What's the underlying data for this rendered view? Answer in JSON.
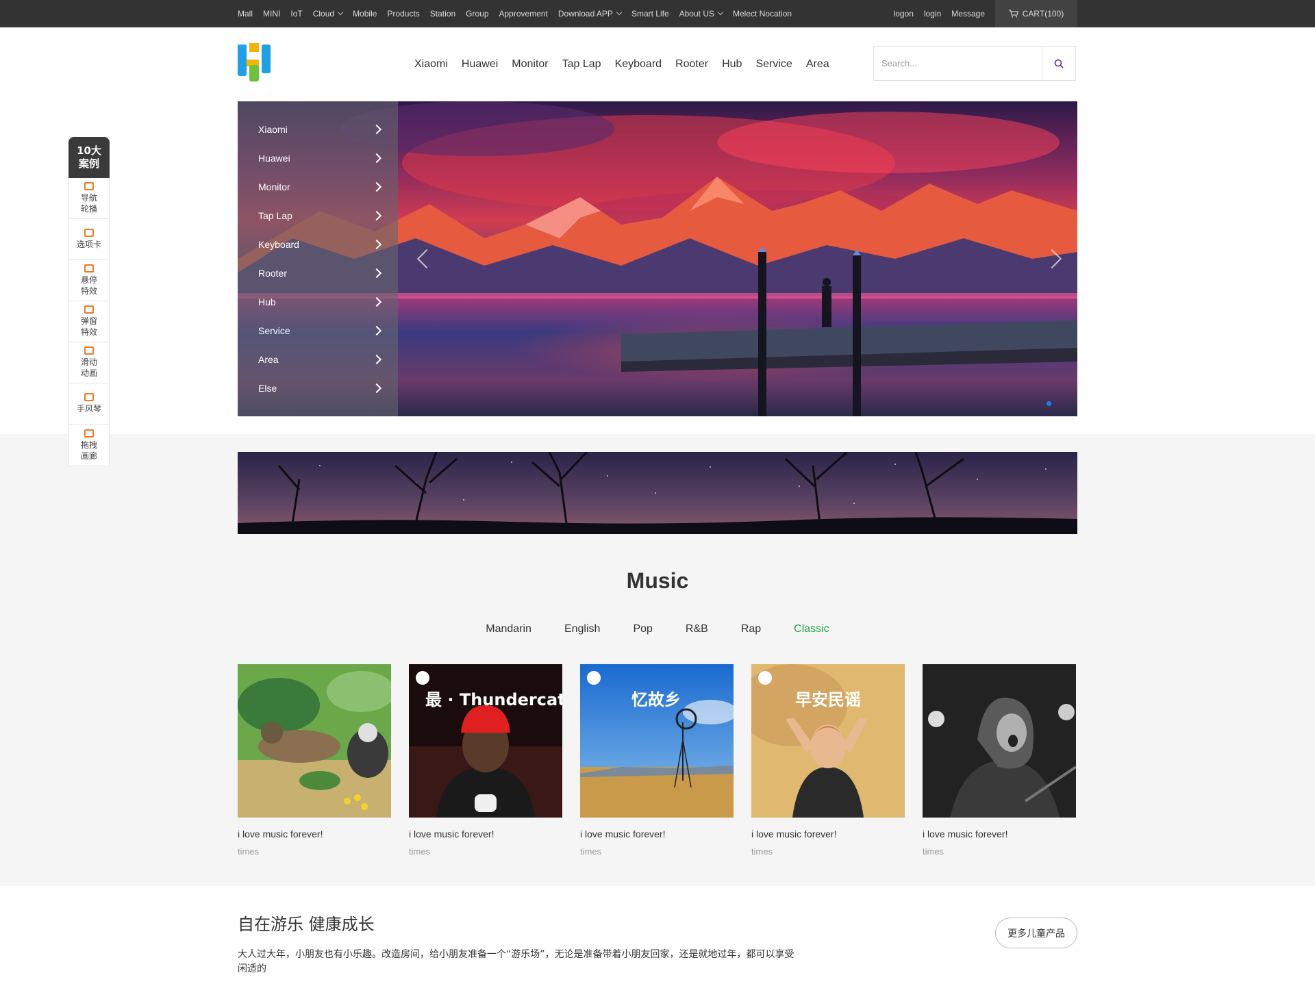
{
  "topbar": {
    "left_links": [
      {
        "label": "Mall",
        "dropdown": false
      },
      {
        "label": "MINI",
        "dropdown": false
      },
      {
        "label": "IoT",
        "dropdown": false
      },
      {
        "label": "Cloud",
        "dropdown": true
      },
      {
        "label": "Mobile",
        "dropdown": false
      },
      {
        "label": "Products",
        "dropdown": false
      },
      {
        "label": "Station",
        "dropdown": false
      },
      {
        "label": "Group",
        "dropdown": false
      },
      {
        "label": "Approvement",
        "dropdown": false
      },
      {
        "label": "Download APP",
        "dropdown": true
      },
      {
        "label": "Smart Life",
        "dropdown": false
      },
      {
        "label": "About US",
        "dropdown": true
      },
      {
        "label": "Melect Nocation",
        "dropdown": false
      }
    ],
    "right_links": [
      "logon",
      "login",
      "Message"
    ],
    "cart_label": "CART(100)",
    "cart_icon": "cart-icon"
  },
  "header": {
    "logo": "brand-logo",
    "nav": [
      "Xiaomi",
      "Huawei",
      "Monitor",
      "Tap Lap",
      "Keyboard",
      "Rooter",
      "Hub",
      "Service",
      "Area"
    ],
    "search_placeholder": "Search...",
    "search_value": "",
    "search_icon": "search-icon",
    "accent": "#5b2c83"
  },
  "hero": {
    "categories": [
      "Xiaomi",
      "Huawei",
      "Monitor",
      "Tap Lap",
      "Keyboard",
      "Rooter",
      "Hub",
      "Service",
      "Area",
      "Else"
    ],
    "prev_icon": "chevron-left-icon",
    "next_icon": "chevron-right-icon",
    "slide_count": 1,
    "active_dot_color": "#1a7cf0"
  },
  "music": {
    "title": "Music",
    "tabs": [
      "Mandarin",
      "English",
      "Pop",
      "R&B",
      "Rap",
      "Classic"
    ],
    "active_tab": "Classic",
    "active_color": "#1fa54a",
    "cards": [
      {
        "title": "i love music forever!",
        "sub": "times",
        "cover_text": ""
      },
      {
        "title": "i love music forever!",
        "sub": "times",
        "cover_text": "最 · Thundercat"
      },
      {
        "title": "i love music forever!",
        "sub": "times",
        "cover_text": "忆故乡"
      },
      {
        "title": "i love music forever!",
        "sub": "times",
        "cover_text": "早安民谣"
      },
      {
        "title": "i love music forever!",
        "sub": "times",
        "cover_text": ""
      }
    ]
  },
  "kids": {
    "title": "自在游乐 健康成长",
    "button": "更多儿童产品",
    "desc": "大人过大年，小朋友也有小乐趣。改造房间，给小朋友准备一个“游乐场”，无论是准备带着小朋友回家，还是就地过年，都可以享受 闲适的"
  },
  "sidebar": {
    "head": [
      "10大",
      "案例"
    ],
    "items": [
      {
        "label": "导航轮播",
        "icon": "carousel-icon"
      },
      {
        "label": "选项卡",
        "icon": "tab-icon"
      },
      {
        "label": "悬停特效",
        "icon": "grid-icon"
      },
      {
        "label": "弹窗特效",
        "icon": "window-icon"
      },
      {
        "label": "滑动动画",
        "icon": "star-icon"
      },
      {
        "label": "手风琴",
        "icon": "accordion-icon"
      },
      {
        "label": "拖拽画廊",
        "icon": "gallery-icon"
      }
    ],
    "accent": "#f07a26"
  }
}
